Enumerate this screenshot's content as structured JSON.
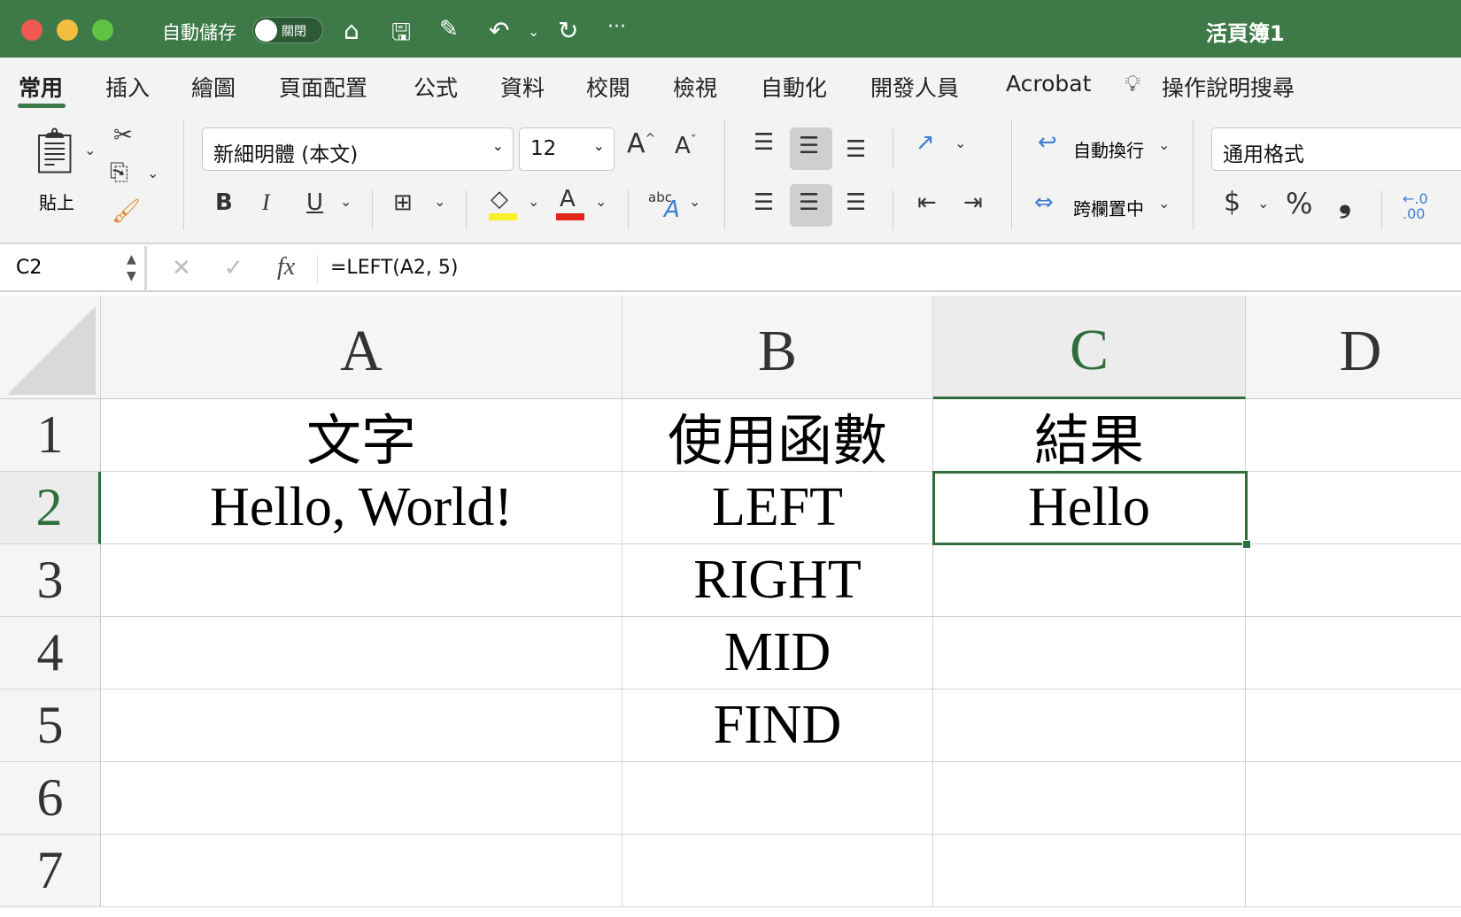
{
  "titlebar": {
    "autosave_label": "自動儲存",
    "autosave_state": "關閉",
    "workbook_title": "活頁簿1",
    "more": "···"
  },
  "tabs": [
    "常用",
    "插入",
    "繪圖",
    "頁面配置",
    "公式",
    "資料",
    "校閱",
    "檢視",
    "自動化",
    "開發人員",
    "Acrobat",
    "操作說明搜尋"
  ],
  "ribbon": {
    "paste_label": "貼上",
    "font_name": "新細明體 (本文)",
    "font_size": "12",
    "wrap_text": "自動換行",
    "merge_center": "跨欄置中",
    "number_format": "通用格式",
    "bold": "B",
    "italic": "I",
    "underline": "U",
    "font_color_letter": "A",
    "currency": "$",
    "percent": "%",
    "comma": "❟",
    "grow": "A",
    "shrink": "A",
    "abc": "abc",
    "dec": "←.0 .00",
    "fill_color": "#f8f02a",
    "font_color": "#e0261d"
  },
  "formula_bar": {
    "name_box": "C2",
    "cancel": "✕",
    "enter": "✓",
    "fx": "fx",
    "formula": "=LEFT(A2, 5)"
  },
  "sheet": {
    "columns": [
      "A",
      "B",
      "C",
      "D"
    ],
    "rows": [
      "1",
      "2",
      "3",
      "4",
      "5",
      "6",
      "7"
    ],
    "cells": [
      [
        "文字",
        "使用函數",
        "結果",
        ""
      ],
      [
        "Hello, World!",
        "LEFT",
        "Hello",
        ""
      ],
      [
        "",
        "RIGHT",
        "",
        ""
      ],
      [
        "",
        "MID",
        "",
        ""
      ],
      [
        "",
        "FIND",
        "",
        ""
      ],
      [
        "",
        "",
        "",
        ""
      ],
      [
        "",
        "",
        "",
        ""
      ]
    ],
    "selected": "C2"
  }
}
